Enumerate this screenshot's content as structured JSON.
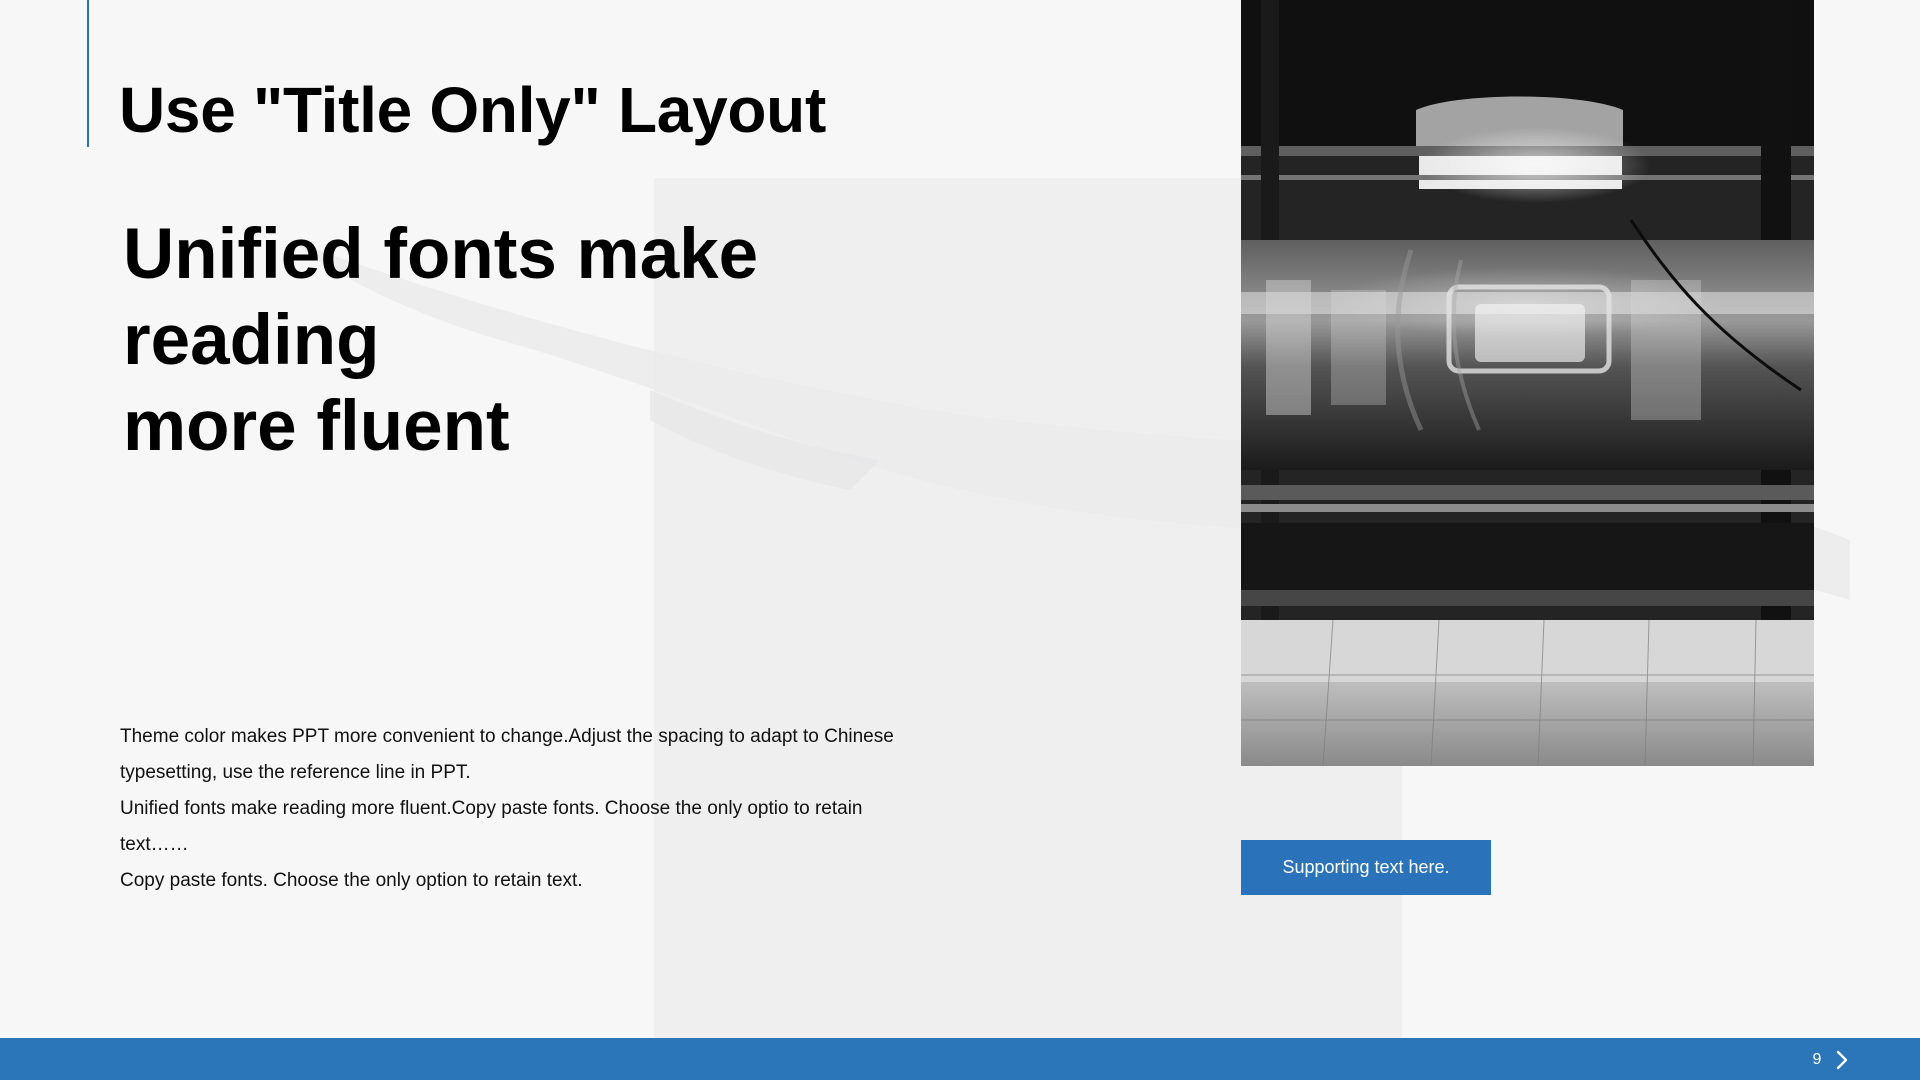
{
  "slide": {
    "title": "Use \"Title Only\" Layout",
    "headline": {
      "line_1": "Unified fonts make",
      "line_2": "reading",
      "line_3": "more fluent"
    },
    "body": {
      "paragraph_1": "Theme  color makes PPT more convenient  to change.Adjust  the spacing to adapt to Chinese  typesetting, use the reference line in PPT.",
      "paragraph_2": "Unified  fonts make reading more fluent.Copy paste fonts. Choose the only optio to retain text……",
      "paragraph_3": "Copy paste  fonts. Choose the only option to retain text."
    },
    "photo": {
      "description_icon": "subway-platform-image"
    },
    "supporting_button": {
      "label": "Supporting text here."
    }
  },
  "footer": {
    "page_number": "9",
    "next_icon": "chevron-right-icon"
  },
  "colors": {
    "accent": "#2a73bb",
    "footer": "#2a76b9",
    "background": "#f7f7f8",
    "panel": "#efeff0",
    "text": "#000000"
  }
}
